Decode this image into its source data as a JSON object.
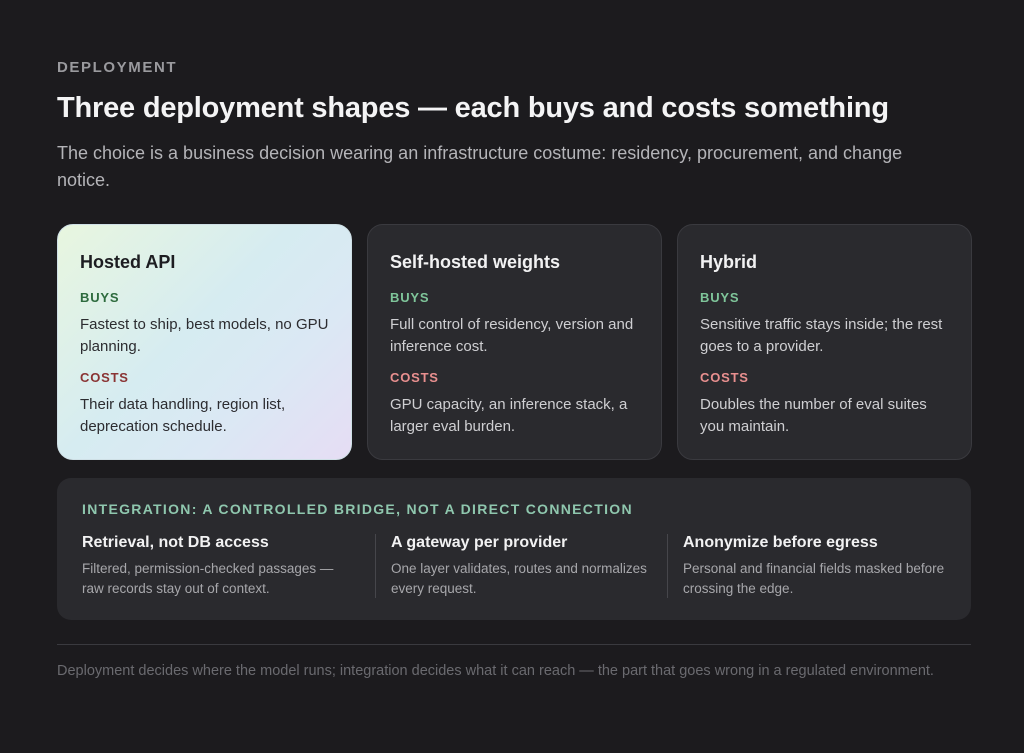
{
  "eyebrow": "DEPLOYMENT",
  "title": "Three deployment shapes — each buys and costs something",
  "subtitle": "The choice is a business decision wearing an infrastructure costume: residency, procurement, and change notice.",
  "cards": [
    {
      "title": "Hosted API",
      "buys_label": "BUYS",
      "buys": "Fastest to ship, best models, no GPU planning.",
      "costs_label": "COSTS",
      "costs": "Their data handling, region list, deprecation schedule."
    },
    {
      "title": "Self-hosted weights",
      "buys_label": "BUYS",
      "buys": "Full control of residency, version and inference cost.",
      "costs_label": "COSTS",
      "costs": "GPU capacity, an inference stack, a larger eval burden."
    },
    {
      "title": "Hybrid",
      "buys_label": "BUYS",
      "buys": "Sensitive traffic stays inside; the rest goes to a provider.",
      "costs_label": "COSTS",
      "costs": "Doubles the number of eval suites you maintain."
    }
  ],
  "integration": {
    "heading": "INTEGRATION: A CONTROLLED BRIDGE, NOT A DIRECT CONNECTION",
    "columns": [
      {
        "title": "Retrieval, not DB access",
        "body": "Filtered, permission-checked passages — raw records stay out of context."
      },
      {
        "title": "A gateway per provider",
        "body": "One layer validates, routes and normalizes every request."
      },
      {
        "title": "Anonymize before egress",
        "body": "Personal and financial fields masked before crossing the edge."
      }
    ]
  },
  "footnote": "Deployment decides where the model runs; integration decides what it can reach — the part that goes wrong in a regulated environment."
}
